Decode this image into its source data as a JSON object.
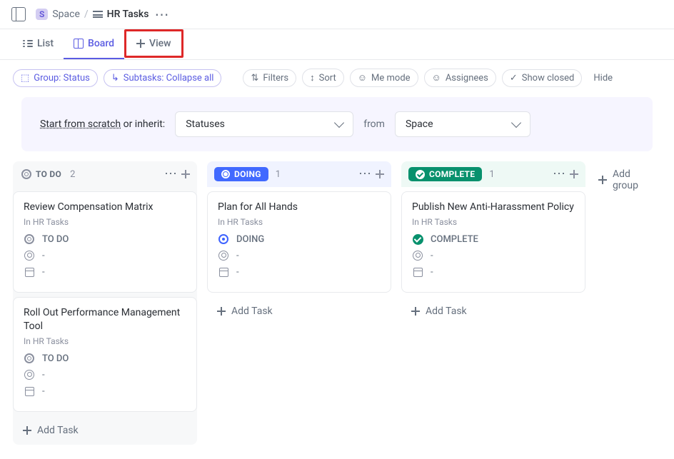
{
  "breadcrumb": {
    "space_badge": "S",
    "space_label": "Space",
    "current": "HR Tasks"
  },
  "view_tabs": {
    "list": "List",
    "board": "Board",
    "add_view": "View"
  },
  "filters": {
    "group_status": "Group: Status",
    "subtasks": "Subtasks: Collapse all",
    "filters": "Filters",
    "sort": "Sort",
    "me_mode": "Me mode",
    "assignees": "Assignees",
    "show_closed": "Show closed",
    "hide": "Hide"
  },
  "inherit_banner": {
    "start_from_scratch": "Start from scratch",
    "or_inherit": " or inherit:",
    "statuses": "Statuses",
    "from": "from",
    "space": "Space"
  },
  "columns": [
    {
      "status": "TO DO",
      "variant": "todo",
      "count": "2",
      "cards": [
        {
          "title": "Review Compensation Matrix",
          "location": "In HR Tasks",
          "status_text": "TO DO",
          "assignee": "-",
          "date": "-"
        },
        {
          "title": "Roll Out Performance Management Tool",
          "location": "In HR Tasks",
          "status_text": "TO DO",
          "assignee": "-",
          "date": "-"
        }
      ]
    },
    {
      "status": "DOING",
      "variant": "doing",
      "count": "1",
      "cards": [
        {
          "title": "Plan for All Hands",
          "location": "In HR Tasks",
          "status_text": "DOING",
          "assignee": "-",
          "date": "-"
        }
      ]
    },
    {
      "status": "COMPLETE",
      "variant": "done",
      "count": "1",
      "cards": [
        {
          "title": "Publish New Anti-Harassment Policy",
          "location": "In HR Tasks",
          "status_text": "COMPLETE",
          "assignee": "-",
          "date": "-"
        }
      ]
    }
  ],
  "labels": {
    "add_task": "Add Task",
    "add_group": "Add group"
  }
}
